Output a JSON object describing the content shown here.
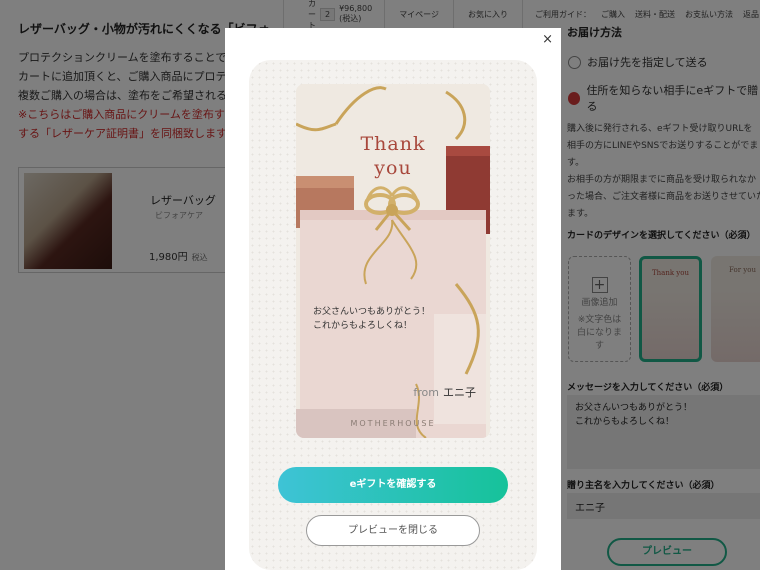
{
  "topbar": {
    "cart_label": "カート",
    "cart_count": "2",
    "cart_total": "¥96,800 (税込)",
    "mypage": "マイページ",
    "favorites": "お気に入り",
    "guide_label": "ご利用ガイド：",
    "guide_items": [
      "ご購入",
      "送料・配送",
      "お支払い方法",
      "返品・交換"
    ]
  },
  "left": {
    "heading": "レザーバッグ・小物が汚れにくくなる「ビフォ",
    "desc_lines": [
      "プロテクションクリームを塗布することで、",
      "カートに追加頂くと、ご購入商品にプロテク",
      "複数ご購入の場合は、塗布をご希望される商"
    ],
    "red_lines": [
      "※こちらはご購入商品にクリームを塗布するサ",
      "する「レザーケア証明書」を同梱致します。"
    ],
    "product": {
      "name": "レザーバッグ",
      "sub": "ビフォアケア",
      "price": "1,980円",
      "tax": "税込"
    }
  },
  "right": {
    "section_title": "お届け方法",
    "radio_1": "お届け先を指定して送る",
    "radio_2": "住所を知らない相手にeギフトで贈る",
    "info_lines": [
      "購入後に発行される、eギフト受け取りURLを",
      "相手の方にLINEやSNSでお送りすることがでま",
      "す。",
      "お相手の方が期限までに商品を受け取られなか",
      "った場合、ご注文者様に商品をお送りさせていただ",
      "ます。"
    ],
    "design_label": "カードのデザインを選択してください（必須）",
    "design_add_title": "画像追加",
    "design_add_note": "※文字色は白になります",
    "design_mini_1": "Thank you",
    "design_mini_2": "For you",
    "message_label": "メッセージを入力してください（必須）",
    "message_value": "お父さんいつもありがとう！\nこれからもよろしくね！",
    "sender_label": "贈り主名を入力してください（必須）",
    "sender_value": "エニ子",
    "preview_button": "プレビュー"
  },
  "modal": {
    "close_icon": "×",
    "card": {
      "title_line1": "Thank",
      "title_line2": "you",
      "message": "お父さんいつもありがとう！\nこれからもよろしくね！",
      "from_label": "from",
      "from_name": "エニ子",
      "brand": "MOTHERHOUSE"
    },
    "confirm_button": "eギフトを確認する",
    "close_preview_button": "プレビューを閉じる"
  }
}
